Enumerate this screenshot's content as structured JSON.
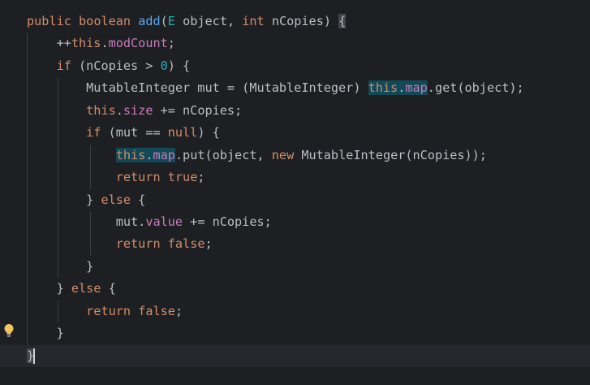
{
  "editor": {
    "colors": {
      "background": "#1e1f22",
      "keyword": "#cf8e6d",
      "method_decl": "#56a8f5",
      "field": "#c77dbb",
      "number": "#2aacb8",
      "default": "#bcbec4",
      "usage_highlight": "#114957"
    },
    "gutter_icon": "lightbulb-icon",
    "lines": [
      {
        "tokens": [
          "public",
          " ",
          "boolean",
          " ",
          "add",
          "(",
          "E",
          " object, ",
          "int",
          " nCopies) ",
          "{"
        ]
      },
      {
        "tokens": [
          "++",
          "this",
          ".",
          "modCount",
          ";"
        ]
      },
      {
        "tokens": [
          "if",
          " (nCopies > ",
          "0",
          ") {"
        ]
      },
      {
        "tokens": [
          "MutableInteger mut = (MutableInteger) ",
          "this",
          ".",
          "map",
          ".get(object);"
        ]
      },
      {
        "tokens": [
          "this",
          ".",
          "size",
          " += nCopies;"
        ]
      },
      {
        "tokens": [
          "if",
          " (mut == ",
          "null",
          ") {"
        ]
      },
      {
        "tokens": [
          "this",
          ".",
          "map",
          ".put(object, ",
          "new",
          " MutableInteger(nCopies));"
        ]
      },
      {
        "tokens": [
          "return",
          " ",
          "true",
          ";"
        ]
      },
      {
        "tokens": [
          "} ",
          "else",
          " {"
        ]
      },
      {
        "tokens": [
          "mut.",
          "value",
          " += nCopies;"
        ]
      },
      {
        "tokens": [
          "return",
          " ",
          "false",
          ";"
        ]
      },
      {
        "tokens": [
          "}"
        ]
      },
      {
        "tokens": [
          "} ",
          "else",
          " {"
        ]
      },
      {
        "tokens": [
          "return",
          " ",
          "false",
          ";"
        ]
      },
      {
        "tokens": [
          "}"
        ]
      },
      {
        "tokens": [
          "}"
        ]
      }
    ]
  }
}
